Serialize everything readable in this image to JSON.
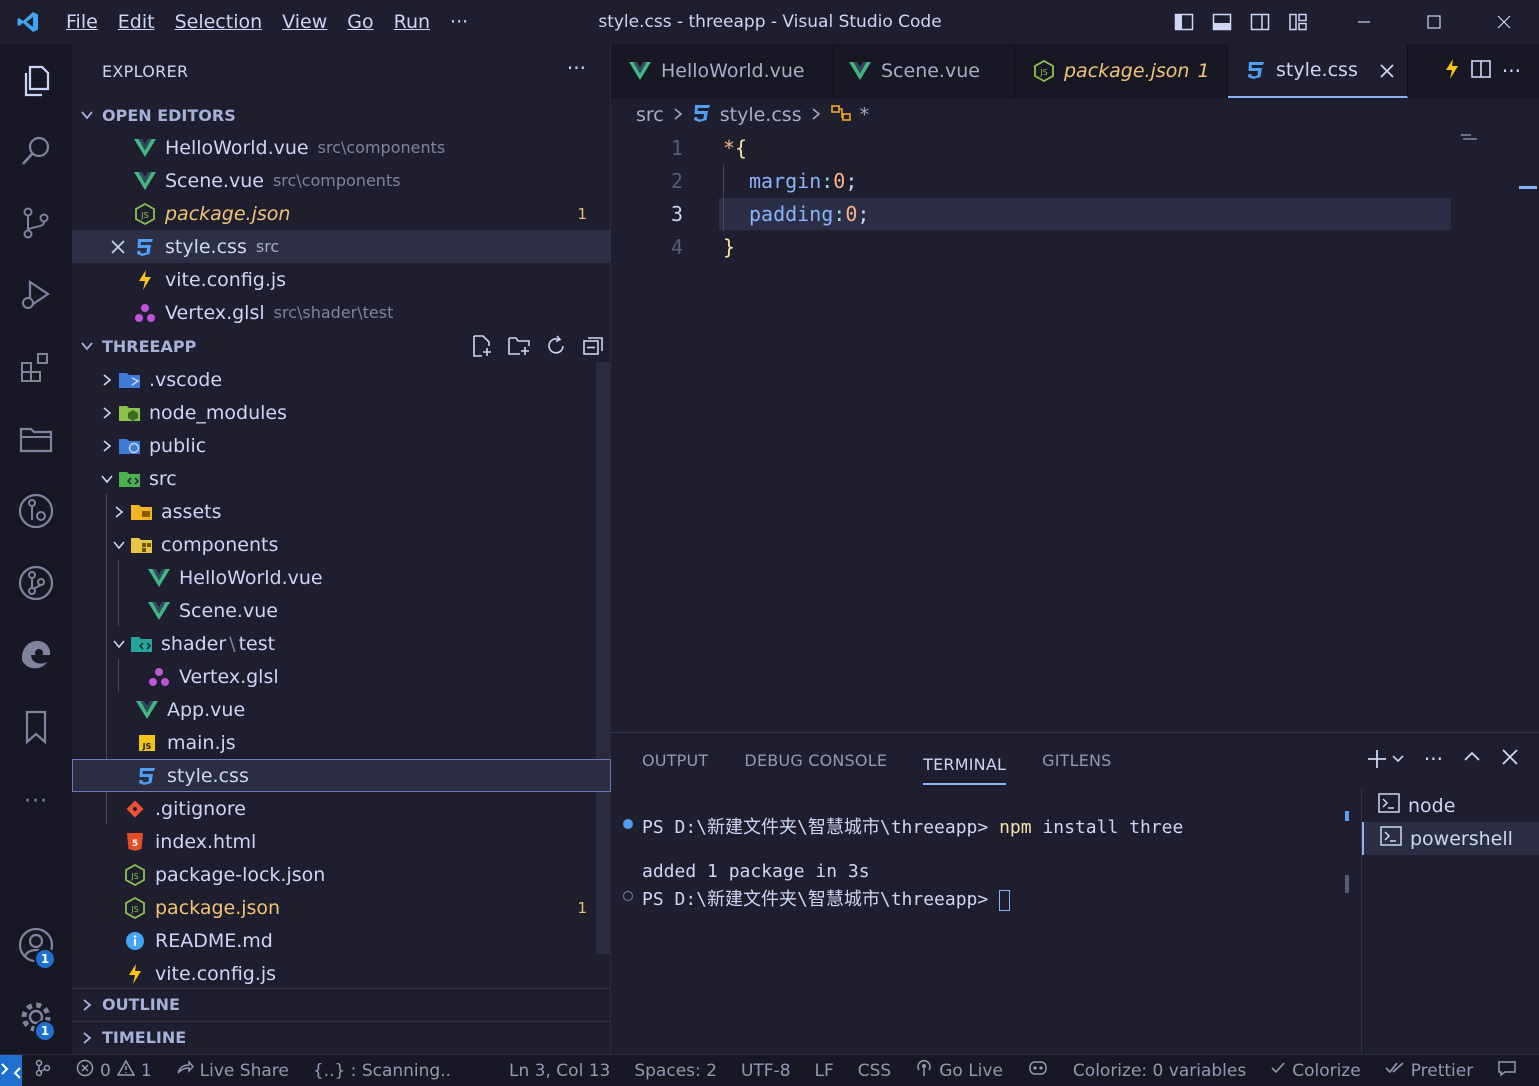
{
  "window": {
    "title": "style.css - threeapp - Visual Studio Code",
    "menu": [
      "File",
      "Edit",
      "Selection",
      "View",
      "Go",
      "Run"
    ],
    "more": "···"
  },
  "activity": {
    "accounts_badge": "1",
    "settings_badge": "1",
    "more": "···"
  },
  "sidebar": {
    "title": "EXPLORER",
    "more": "···",
    "open_editors": {
      "header": "OPEN EDITORS",
      "items": [
        {
          "name": "HelloWorld.vue",
          "path": "src\\components",
          "icon": "vue-icon"
        },
        {
          "name": "Scene.vue",
          "path": "src\\components",
          "icon": "vue-icon"
        },
        {
          "name": "package.json",
          "path": "",
          "icon": "nodejs-icon",
          "count": "1"
        },
        {
          "name": "style.css",
          "path": "src",
          "icon": "css-icon"
        },
        {
          "name": "vite.config.js",
          "path": "",
          "icon": "vite-icon"
        },
        {
          "name": "Vertex.glsl",
          "path": "src\\shader\\test",
          "icon": "glsl-icon"
        }
      ]
    },
    "project": {
      "header": "THREEAPP",
      "tree": [
        {
          "name": ".vscode"
        },
        {
          "name": "node_modules"
        },
        {
          "name": "public"
        },
        {
          "name": "src"
        },
        {
          "name": "assets"
        },
        {
          "name": "components"
        },
        {
          "name": "HelloWorld.vue"
        },
        {
          "name": "Scene.vue"
        },
        {
          "name": "shader",
          "sep": "\\",
          "sub": "test"
        },
        {
          "name": "Vertex.glsl"
        },
        {
          "name": "App.vue"
        },
        {
          "name": "main.js"
        },
        {
          "name": "style.css"
        },
        {
          "name": ".gitignore"
        },
        {
          "name": "index.html"
        },
        {
          "name": "package-lock.json"
        },
        {
          "name": "package.json",
          "count": "1"
        },
        {
          "name": "README.md"
        },
        {
          "name": "vite.config.js"
        }
      ]
    },
    "outline": "OUTLINE",
    "timeline": "TIMELINE"
  },
  "tabs": [
    {
      "label": "HelloWorld.vue",
      "count": ""
    },
    {
      "label": "Scene.vue",
      "count": ""
    },
    {
      "label": "package.json",
      "count": "1"
    },
    {
      "label": "style.css",
      "count": ""
    }
  ],
  "breadcrumb": {
    "folder": "src",
    "file": "style.css",
    "symbol": "*"
  },
  "editor": {
    "line_numbers": [
      "1",
      "2",
      "3",
      "4"
    ],
    "lines": [
      {
        "sel": "*",
        "brace": "{"
      },
      {
        "prop": "margin",
        "colon": ":",
        "val": "0",
        "semi": ";"
      },
      {
        "prop": "padding",
        "colon": ":",
        "val": "0",
        "semi": ";"
      },
      {
        "brace": "}"
      }
    ]
  },
  "panel": {
    "tabs": [
      "OUTPUT",
      "DEBUG CONSOLE",
      "TERMINAL",
      "GITLENS"
    ],
    "terminal": {
      "line1_prompt": "PS D:\\新建文件夹\\智慧城市\\threeapp>",
      "line1_cmd": "npm",
      "line1_args": "install three",
      "line2": "added 1 package in 3s",
      "line3_prompt": "PS D:\\新建文件夹\\智慧城市\\threeapp>"
    },
    "terminals": [
      "node",
      "powershell"
    ],
    "more": "···"
  },
  "status": {
    "errors": "0",
    "warnings": "1",
    "live_share": "Live Share",
    "scanning": "{..} : Scanning..",
    "position": "Ln 3, Col 13",
    "spaces": "Spaces: 2",
    "encoding": "UTF-8",
    "eol": "LF",
    "language": "CSS",
    "go_live": "Go Live",
    "colorize_vars": "Colorize: 0 variables",
    "colorize": "Colorize",
    "prettier": "Prettier"
  },
  "colors": {
    "accent": "#89b4fa",
    "vue": "#41b883",
    "css": "#4e9ff5",
    "json": "#8bc34a",
    "warning": "#f0c674",
    "remote": "#1f6fd1"
  }
}
